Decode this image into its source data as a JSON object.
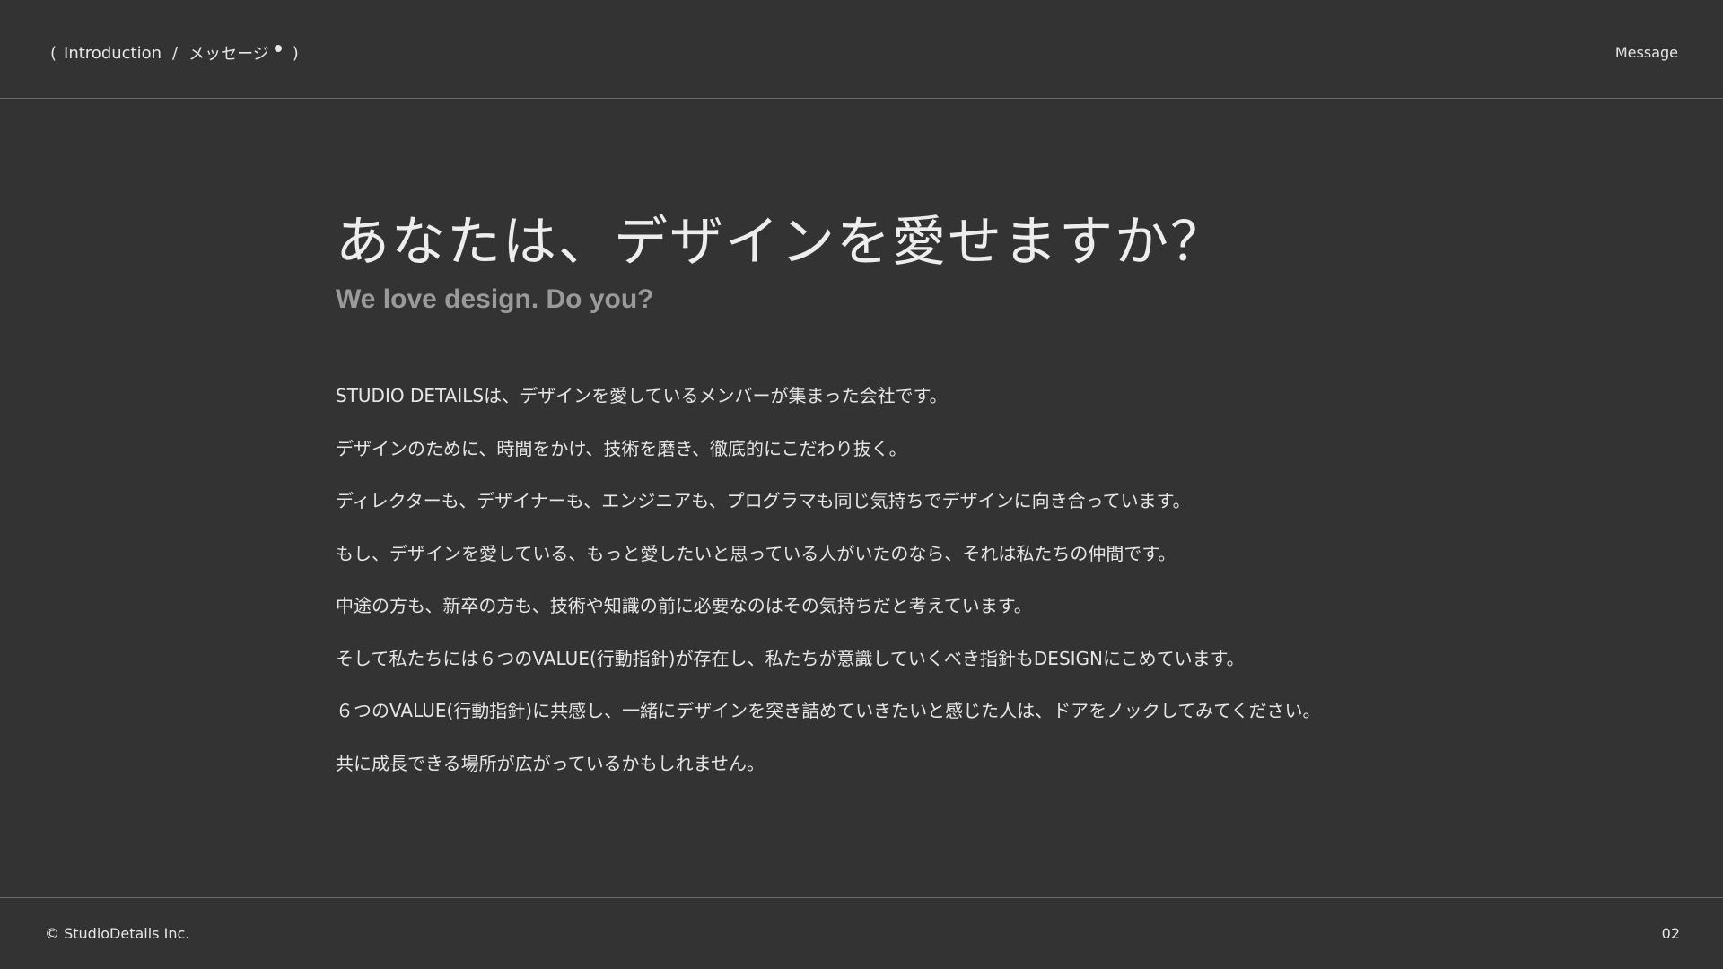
{
  "header": {
    "breadcrumb": {
      "open_paren": "(",
      "section": "Introduction",
      "separator": "/",
      "page": "メッセージ",
      "close_paren": ")"
    },
    "right_label": "Message"
  },
  "main": {
    "title": "あなたは、デザインを愛せますか？",
    "subtitle": "We love design. Do you?",
    "paragraphs": [
      "STUDIO DETAILSは、デザインを愛しているメンバーが集まった会社です。",
      "デザインのために、時間をかけ、技術を磨き、徹底的にこだわり抜く。",
      "ディレクターも、デザイナーも、エンジニアも、プログラマも同じ気持ちでデザインに向き合っています。",
      "もし、デザインを愛している、もっと愛したいと思っている人がいたのなら、それは私たちの仲間です。",
      "中途の方も、新卒の方も、技術や知識の前に必要なのはその気持ちだと考えています。",
      "そして私たちには６つのVALUE(行動指針)が存在し、私たちが意識していくべき指針もDESIGNにこめています。",
      "６つのVALUE(行動指針)に共感し、一緒にデザインを突き詰めていきたいと感じた人は、ドアをノックしてみてください。",
      "共に成長できる場所が広がっているかもしれません。"
    ]
  },
  "footer": {
    "copyright": "© StudioDetails Inc.",
    "page_number": "02"
  }
}
